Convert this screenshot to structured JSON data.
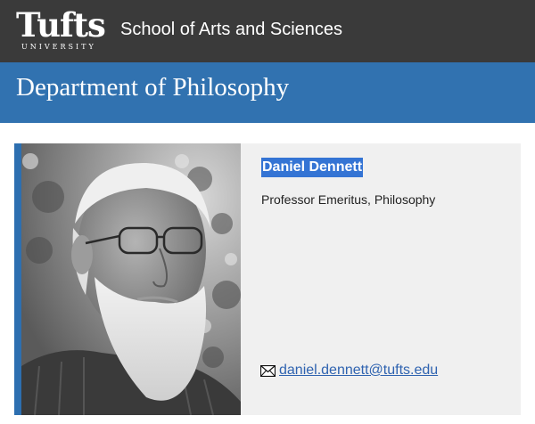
{
  "header": {
    "logo_word": "Tufts",
    "logo_subtitle": "UNIVERSITY",
    "school_label": "School of Arts and Sciences"
  },
  "department": {
    "title": "Department of Philosophy"
  },
  "profile": {
    "name": "Daniel Dennett",
    "title": "Professor Emeritus, Philosophy",
    "email": "daniel.dennett@tufts.edu",
    "email_icon": "envelope-icon"
  },
  "colors": {
    "header_bg": "#3a3a3a",
    "department_bar": "#3172b0",
    "card_bg": "#f0f0f0",
    "card_accent": "#2d6fb0",
    "name_highlight": "#3474d4",
    "link": "#2f63b0"
  }
}
